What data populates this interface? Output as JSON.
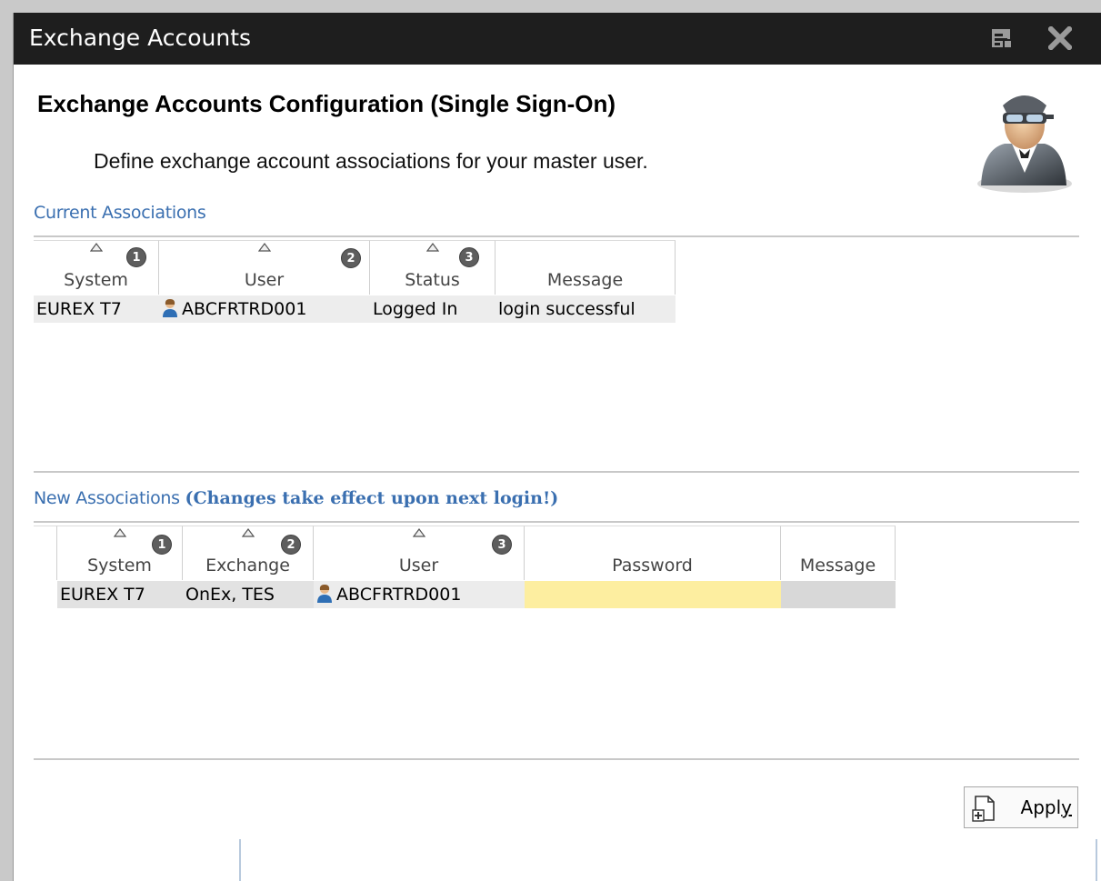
{
  "window": {
    "title": "Exchange Accounts",
    "restore_icon": "restore-window-icon",
    "close_icon": "close-icon"
  },
  "header": {
    "title": "Exchange Accounts Configuration (Single Sign-On)",
    "subtitle": "Define exchange account associations for your master user.",
    "avatar_icon": "admin-user-avatar-icon"
  },
  "current": {
    "section_label": "Current Associations",
    "columns": [
      {
        "label": "System",
        "sort_order": "1"
      },
      {
        "label": "User",
        "sort_order": "2"
      },
      {
        "label": "Status",
        "sort_order": "3"
      },
      {
        "label": "Message",
        "sort_order": ""
      }
    ],
    "rows": [
      {
        "system": "EUREX T7",
        "user": "ABCFRTRD001",
        "status": "Logged In",
        "message": "login successful"
      }
    ]
  },
  "new": {
    "section_label": "New Associations",
    "section_note": "(Changes take effect upon next login!)",
    "columns": [
      {
        "label": "System",
        "sort_order": "1"
      },
      {
        "label": "Exchange",
        "sort_order": "2"
      },
      {
        "label": "User",
        "sort_order": "3"
      },
      {
        "label": "Password",
        "sort_order": ""
      },
      {
        "label": "Message",
        "sort_order": ""
      }
    ],
    "rows": [
      {
        "system": "EUREX T7",
        "exchange": "OnEx, TES",
        "user": "ABCFRTRD001",
        "password": "",
        "message": ""
      }
    ]
  },
  "footer": {
    "apply_label_prefix": "Appl",
    "apply_label_mnemonic": "y"
  },
  "colors": {
    "titlebar": "#1e1e1e",
    "section_label": "#3a6fb0",
    "password_field": "#fdeeA0",
    "row_bg": "#ededed"
  }
}
